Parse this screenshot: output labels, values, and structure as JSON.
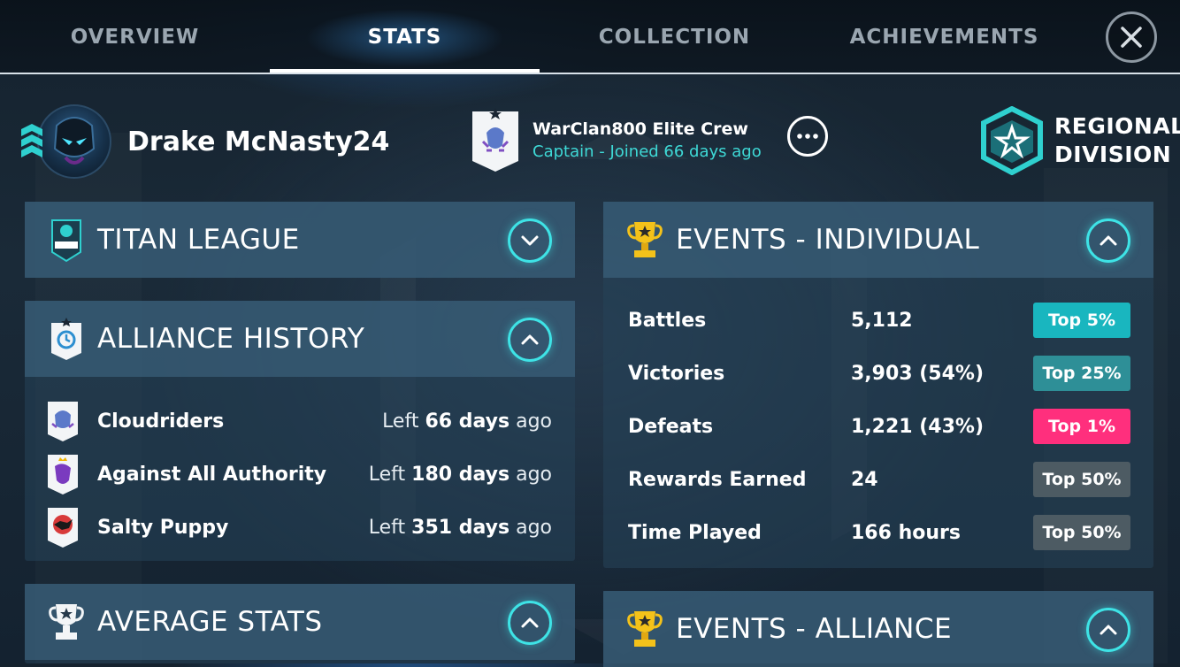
{
  "nav": {
    "tabs": [
      {
        "label": "OVERVIEW"
      },
      {
        "label": "STATS"
      },
      {
        "label": "COLLECTION"
      },
      {
        "label": "ACHIEVEMENTS"
      }
    ],
    "active_tab": "STATS"
  },
  "profile": {
    "name": "Drake McNasty24",
    "rank_icon": "chevron-stack-icon",
    "avatar_icon": "helmet-avatar"
  },
  "clan": {
    "name": "WarClan800 Elite Crew",
    "role": "Captain - Joined 66 days ago",
    "badge_icon": "clan-shield-icon"
  },
  "division": {
    "line1": "REGIONAL",
    "line2": "DIVISION",
    "icon": "star-hexagon-icon"
  },
  "panels": {
    "titan_league": {
      "title": "TITAN LEAGUE",
      "icon": "titan-league-logo",
      "state": "collapsed"
    },
    "alliance_history": {
      "title": "ALLIANCE HISTORY",
      "icon": "clock-shield-icon",
      "state": "expanded",
      "items": [
        {
          "name": "Cloudriders",
          "prefix": "Left",
          "days": "66 days",
          "suffix": "ago"
        },
        {
          "name": "Against All Authority",
          "prefix": "Left",
          "days": "180 days",
          "suffix": "ago"
        },
        {
          "name": "Salty Puppy",
          "prefix": "Left",
          "days": "351 days",
          "suffix": "ago"
        }
      ]
    },
    "average_stats": {
      "title": "AVERAGE STATS",
      "icon": "trophy-icon",
      "state": "expanded"
    },
    "events_individual": {
      "title": "EVENTS - INDIVIDUAL",
      "icon": "gold-trophy-icon",
      "state": "expanded",
      "rows": [
        {
          "label": "Battles",
          "value": "5,112",
          "rank": "Top 5%"
        },
        {
          "label": "Victories",
          "value": "3,903 (54%)",
          "rank": "Top 25%"
        },
        {
          "label": "Defeats",
          "value": "1,221 (43%)",
          "rank": "Top 1%"
        },
        {
          "label": "Rewards Earned",
          "value": "24",
          "rank": "Top 50%"
        },
        {
          "label": "Time Played",
          "value": "166 hours",
          "rank": "Top 50%"
        }
      ]
    },
    "events_alliance": {
      "title": "EVENTS - ALLIANCE",
      "icon": "gold-trophy-icon",
      "state": "expanded"
    }
  },
  "colors": {
    "accent_cyan": "#3ee3e6",
    "rank_top5": "#19b6bf",
    "rank_top25": "#2e8f97",
    "rank_top1": "#ff2f7d",
    "rank_top50": "#4d5b63",
    "clan_role": "#3ed9d6"
  }
}
